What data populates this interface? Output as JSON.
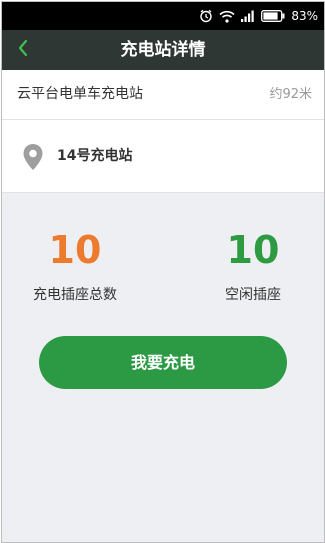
{
  "status_bar": {
    "battery": "83%"
  },
  "header": {
    "title": "充电站详情"
  },
  "station": {
    "name": "云平台电单车充电站",
    "distance": "约92米"
  },
  "location": {
    "name": "14号充电站"
  },
  "stats": {
    "total": {
      "value": "10",
      "label": "充电插座总数"
    },
    "free": {
      "value": "10",
      "label": "空闲插座"
    }
  },
  "actions": {
    "charge_label": "我要充电"
  },
  "colors": {
    "nav_bg": "#2f3734",
    "accent_green": "#2c9a45",
    "stat_orange": "#ed7b2e",
    "stat_green": "#2e9b43",
    "page_bg": "#eeeff3"
  },
  "icons": [
    "alarm-icon",
    "wifi-icon",
    "signal-icon",
    "battery-icon",
    "back-arrow-icon",
    "location-pin-icon"
  ]
}
